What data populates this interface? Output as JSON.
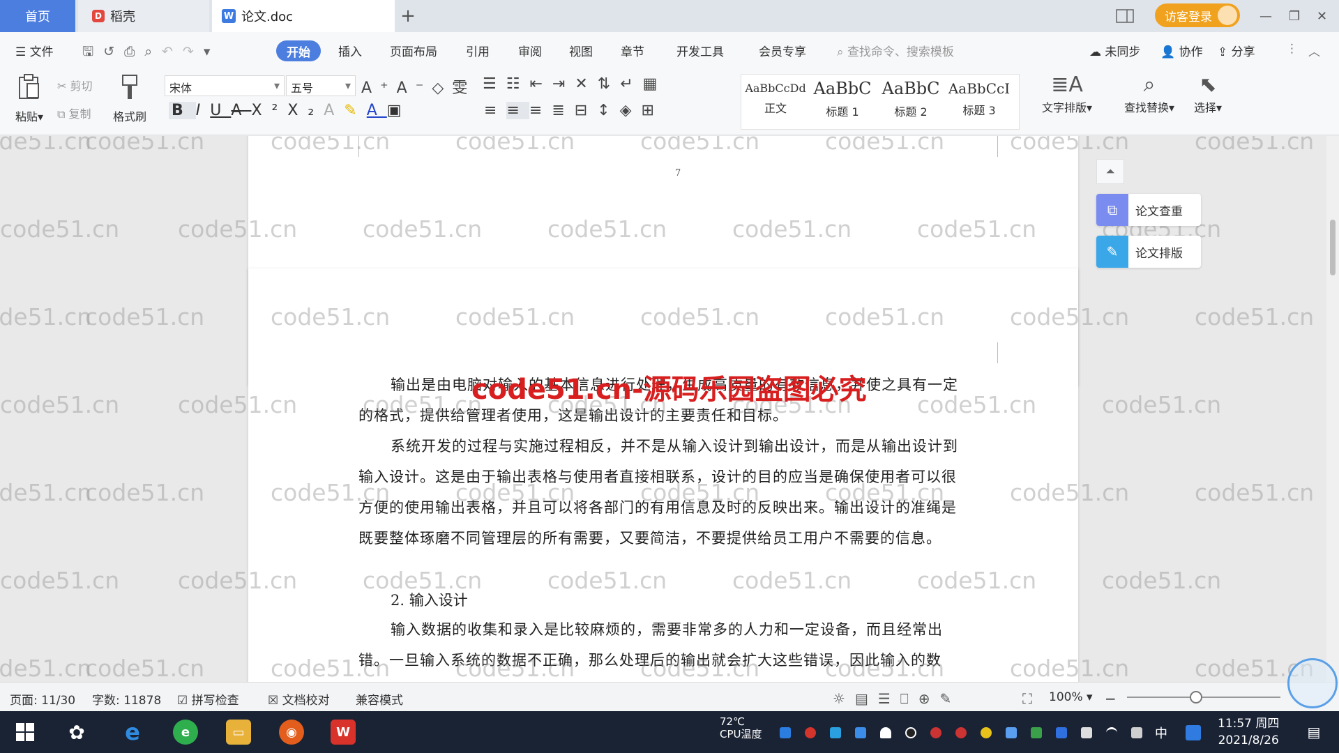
{
  "tabs": {
    "home": "首页",
    "daoke": "稻壳",
    "doc": "论文.doc",
    "new_tab": "+"
  },
  "titlebar": {
    "login": "访客登录",
    "minimize": "—",
    "restore": "❐",
    "close": "✕"
  },
  "menu": {
    "file": "文件",
    "active": "开始",
    "items": [
      "插入",
      "页面布局",
      "引用",
      "审阅",
      "视图",
      "章节",
      "开发工具",
      "会员专享"
    ],
    "search_placeholder": "查找命令、搜索模板",
    "sync": "未同步",
    "collab": "协作",
    "share": "分享"
  },
  "ribbon": {
    "paste": "粘贴",
    "cut": "剪切",
    "copy": "复制",
    "format_painter": "格式刷",
    "font_name": "宋体",
    "font_size": "五号",
    "styles": [
      {
        "sample": "AaBbCcDd",
        "label": "正文"
      },
      {
        "sample": "AaBbC",
        "label": "标题 1"
      },
      {
        "sample": "AaBbC",
        "label": "标题 2"
      },
      {
        "sample": "AaBbCcI",
        "label": "标题 3"
      }
    ],
    "text_layout": "文字排版",
    "find_replace": "查找替换",
    "select": "选择"
  },
  "document": {
    "page_number": "7",
    "paragraphs": [
      "输出是由电脑对输入的基本信息进行处理，生成高质量的有效信息，并使之具有一定的格式，提供给管理者使用，这是输出设计的主要责任和目标。",
      "系统开发的过程与实施过程相反，并不是从输入设计到输出设计，而是从输出设计到输入设计。这是由于输出表格与使用者直接相联系，设计的目的应当是确保使用者可以很方便的使用输出表格，并且可以将各部门的有用信息及时的反映出来。输出设计的准绳是既要整体琢磨不同管理层的所有需要，又要简洁，不要提供给员工用户不需要的信息。"
    ],
    "heading": "2. 输入设计",
    "paragraph_3": "输入数据的收集和录入是比较麻烦的，需要非常多的人力和一定设备，而且经常出错。一旦输入系统的数据不正确，那么处理后的输出就会扩大这些错误，因此输入的数"
  },
  "watermarks": {
    "tile": "code51.cn",
    "red": "code51.cn-源码乐园盗图必究"
  },
  "side_panel": {
    "check": "论文查重",
    "layout": "论文排版"
  },
  "statusbar": {
    "page": "页面: 11/30",
    "words": "字数: 11878",
    "spell": "拼写检查",
    "proofread": "文档校对",
    "compat": "兼容模式",
    "zoom": "100%"
  },
  "taskbar": {
    "temp": "72℃",
    "cpu": "CPU温度",
    "time": "11:57 周四",
    "date": "2021/8/26",
    "ime": "中"
  },
  "colors": {
    "accent": "#4c7ee0",
    "login": "#f0a11e",
    "red_watermark": "#d81e1e"
  }
}
